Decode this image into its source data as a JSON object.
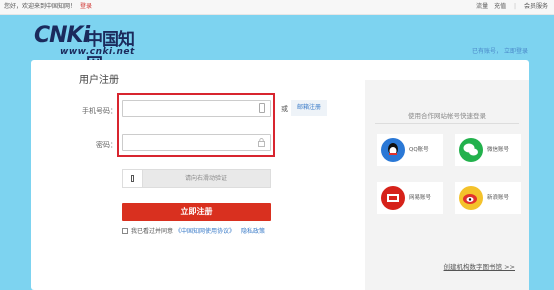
{
  "topbar": {
    "welcome": "您好，欢迎来到中国知网！",
    "login": "登录",
    "recharge": "充值",
    "member": "会员服务",
    "recharge_prefix": "流量"
  },
  "header": {
    "logo_main": "CNKi",
    "logo_cn": "中国知网",
    "logo_url": "www.cnki.net",
    "has_account": "已有账号，",
    "login_now": "立即登录"
  },
  "form": {
    "title": "用户注册",
    "phone_label": "手机号码",
    "phone_value": "",
    "password_label": "密码",
    "password_value": "",
    "or": "或",
    "email_register": "邮箱注册",
    "slider_text": "请向右滑动验证",
    "register_button": "立即注册",
    "agree_text": "我已看过并同意",
    "agreement_link": "《中国知网使用协议》",
    "privacy_link": "隐私政策"
  },
  "partner": {
    "title": "使用合作网站帐号快速登录",
    "items": [
      {
        "label": "QQ账号",
        "color": "#2a78d6"
      },
      {
        "label": "微信账号",
        "color": "#22b14c"
      },
      {
        "label": "网易账号",
        "color": "#d6221a"
      },
      {
        "label": "新浪账号",
        "color": "#f4c22b"
      }
    ],
    "create_library": "创建机构数字图书馆 >>"
  }
}
